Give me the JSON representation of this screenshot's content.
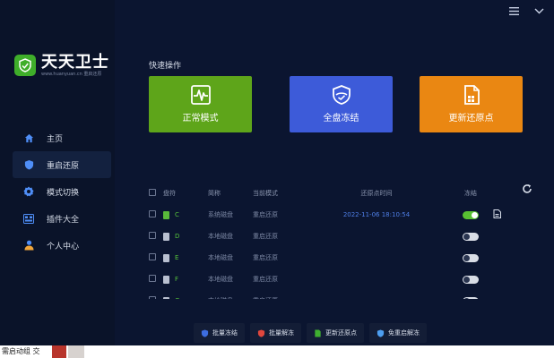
{
  "window": {
    "menu_icon": "hamburger-icon",
    "close_icon": "chevron-down-icon"
  },
  "logo": {
    "title": "天天卫士",
    "subtitle": "www.huanyuan.cn 重启还原"
  },
  "sidebar": {
    "items": [
      {
        "label": "主页",
        "icon": "home-icon",
        "active": false
      },
      {
        "label": "重启还原",
        "icon": "shield-icon",
        "active": true
      },
      {
        "label": "模式切换",
        "icon": "badge-icon",
        "active": false
      },
      {
        "label": "插件大全",
        "icon": "plugin-icon",
        "active": false
      },
      {
        "label": "个人中心",
        "icon": "user-icon",
        "active": false
      }
    ]
  },
  "quick_actions": {
    "title": "快速操作",
    "cards": [
      {
        "label": "正常模式",
        "icon": "pulse-icon",
        "color": "#5ea51a"
      },
      {
        "label": "全盘冻结",
        "icon": "shield-check-icon",
        "color": "#3d5bd9"
      },
      {
        "label": "更新还原点",
        "icon": "document-icon",
        "color": "#ea8712"
      }
    ]
  },
  "table": {
    "headers": {
      "disk": "盘符",
      "name": "简称",
      "mode": "当前模式",
      "time": "还原点时间",
      "freeze": "冻结"
    },
    "rows": [
      {
        "disk": "C",
        "name": "系统磁盘",
        "mode": "重启还原",
        "time": "2022-11-06 18:10:54",
        "frozen": true,
        "system": true
      },
      {
        "disk": "D",
        "name": "本地磁盘",
        "mode": "重启还原",
        "time": "",
        "frozen": false,
        "system": false
      },
      {
        "disk": "E",
        "name": "本地磁盘",
        "mode": "重启还原",
        "time": "",
        "frozen": false,
        "system": false
      },
      {
        "disk": "F",
        "name": "本地磁盘",
        "mode": "重启还原",
        "time": "",
        "frozen": false,
        "system": false
      },
      {
        "disk": "G",
        "name": "本地磁盘",
        "mode": "重启还原",
        "time": "",
        "frozen": false,
        "system": false
      }
    ]
  },
  "bottom_actions": [
    {
      "label": "批量冻结",
      "icon": "shield-icon",
      "color": "#3d6de0"
    },
    {
      "label": "批量解冻",
      "icon": "shield-icon",
      "color": "#e0473d"
    },
    {
      "label": "更新还原点",
      "icon": "document-icon",
      "color": "#3fb030"
    },
    {
      "label": "免重启解冻",
      "icon": "shield-icon",
      "color": "#4d9ef0"
    }
  ],
  "taskbar": {
    "text": "需启动组 交"
  }
}
